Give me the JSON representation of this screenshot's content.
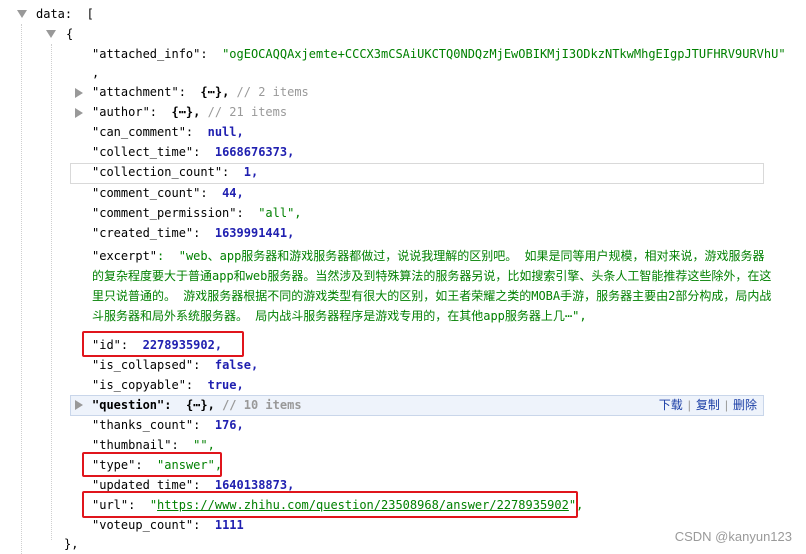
{
  "root_key": "data",
  "root_open": "[",
  "obj_open": "{",
  "obj_close": "},",
  "comma": ",",
  "fields": {
    "attached_info": {
      "key": "\"attached_info\"",
      "value": "\"ogEOCAQQAxjemte+CCCX3mCSAiUKCTQ0NDQzMjEwOBIKMjI3ODkzNTkwMhgEIgpJTUFHRV9URVhU\""
    },
    "attachment": {
      "key": "\"attachment\"",
      "collapsed": "{⋯},",
      "comment": "// 2 items"
    },
    "author": {
      "key": "\"author\"",
      "collapsed": "{⋯},",
      "comment": "// 21 items"
    },
    "can_comment": {
      "key": "\"can_comment\"",
      "value": "null,"
    },
    "collect_time": {
      "key": "\"collect_time\"",
      "value": "1668676373,"
    },
    "collection_count": {
      "key": "\"collection_count\"",
      "value": "1,"
    },
    "comment_count": {
      "key": "\"comment_count\"",
      "value": "44,"
    },
    "comment_permission": {
      "key": "\"comment_permission\"",
      "value": "\"all\","
    },
    "created_time": {
      "key": "\"created_time\"",
      "value": "1639991441,"
    },
    "excerpt": {
      "key": "\"excerpt\"",
      "value": "\"web、app服务器和游戏服务器都做过，说说我理解的区别吧。 如果是同等用户规模，相对来说，游戏服务器的复杂程度要大于普通app和web服务器。当然涉及到特殊算法的服务器另说，比如搜索引擎、头条人工智能推荐这些除外，在这里只说普通的。 游戏服务器根据不同的游戏类型有很大的区别，如王者荣耀之类的MOBA手游，服务器主要由2部分构成，局内战斗服务器和局外系统服务器。 局内战斗服务器程序是游戏专用的，在其他app服务器上几⋯\","
    },
    "id": {
      "key": "\"id\"",
      "value": "2278935902,"
    },
    "is_collapsed": {
      "key": "\"is_collapsed\"",
      "value": "false,"
    },
    "is_copyable": {
      "key": "\"is_copyable\"",
      "value": "true,"
    },
    "question": {
      "key": "\"question\"",
      "collapsed": "{⋯},",
      "comment": "// 10 items"
    },
    "thanks_count": {
      "key": "\"thanks_count\"",
      "value": "176,"
    },
    "thumbnail": {
      "key": "\"thumbnail\"",
      "value": "\"\","
    },
    "type": {
      "key": "\"type\"",
      "value": "\"answer\","
    },
    "updated_time": {
      "key": "\"updated_time\"",
      "value": "1640138873,"
    },
    "url": {
      "key": "\"url\"",
      "quote": "\"",
      "link": "https://www.zhihu.com/question/23508968/answer/2278935902",
      "tail": "\","
    },
    "voteup_count": {
      "key": "\"voteup_count\"",
      "value": "1111"
    }
  },
  "question_actions": {
    "download": "下载",
    "copy": "复制",
    "delete": "删除",
    "sep": "|"
  },
  "watermark": "CSDN @kanyun123",
  "colors": {
    "string": "#008000",
    "number": "#1f1fb0",
    "highlight": "#e0151c"
  }
}
